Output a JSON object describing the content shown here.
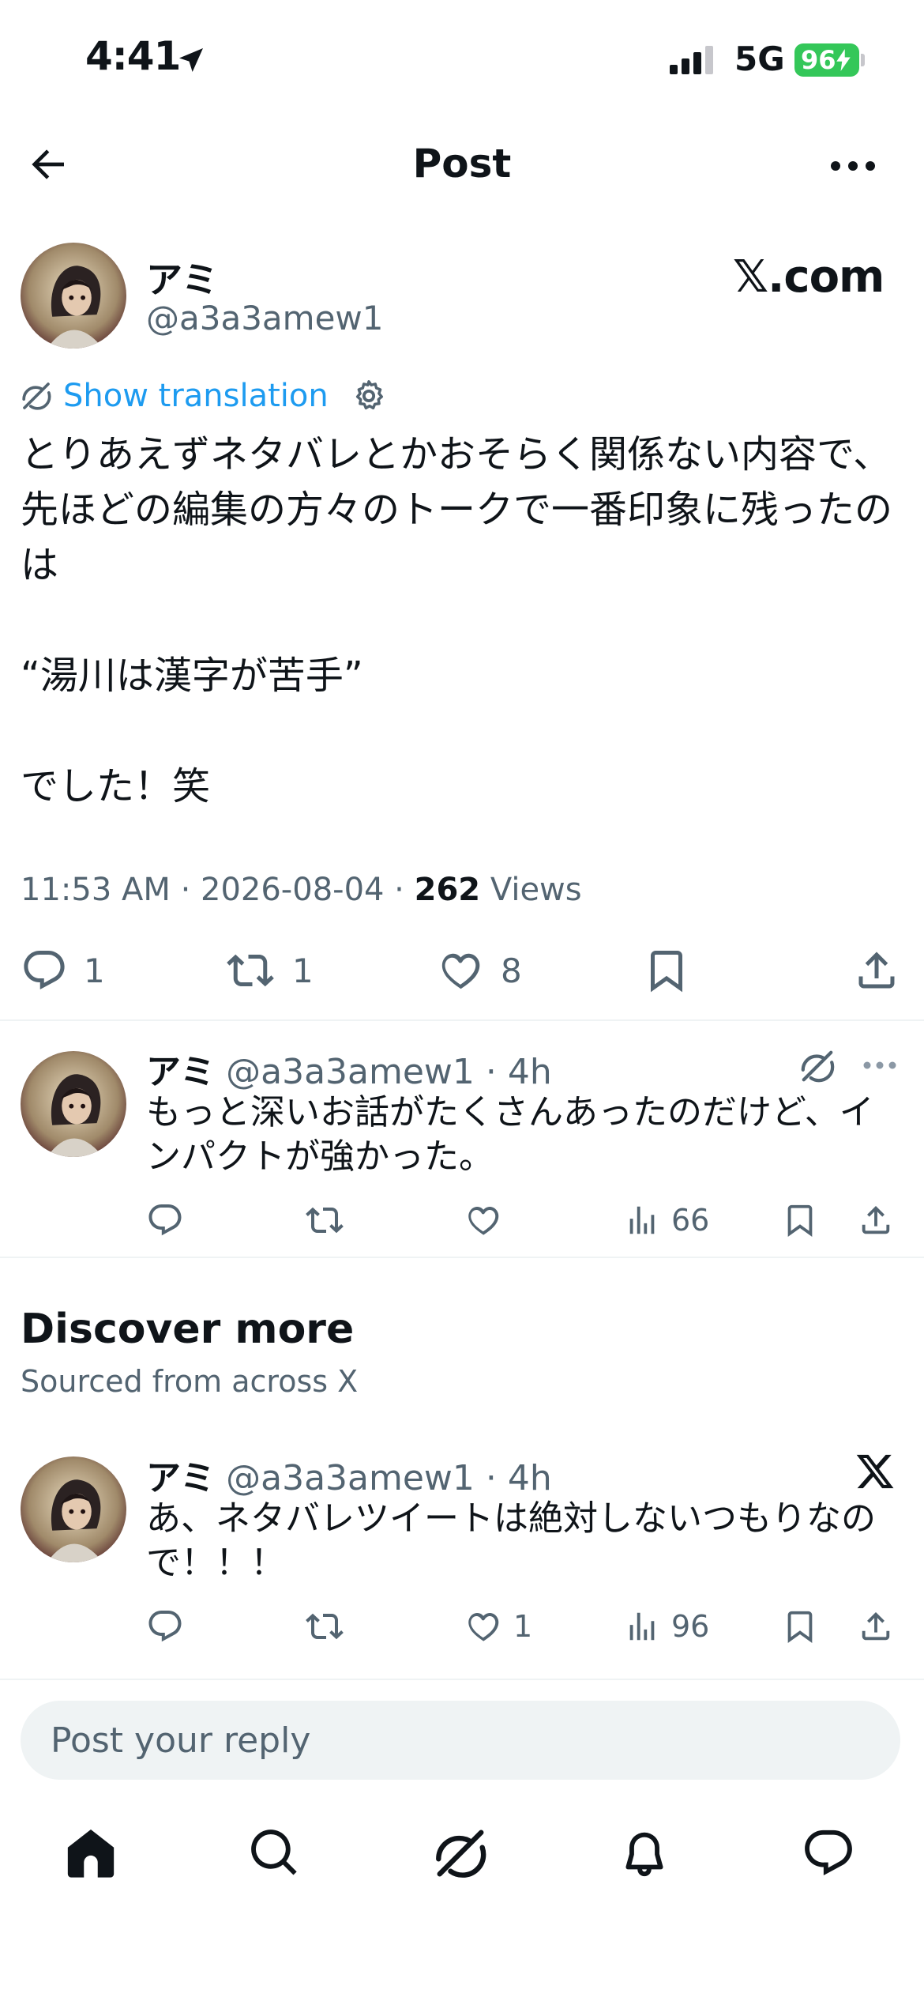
{
  "status_bar": {
    "time": "4:41",
    "network": "5G",
    "battery": "96"
  },
  "header": {
    "title": "Post"
  },
  "main_tweet": {
    "name": "アミ",
    "handle": "@a3a3amew1",
    "source_watermark": "𝕏.com",
    "show_translation": "Show translation",
    "body": "とりあえずネタバレとかおそらく関係ない内容で、先ほどの編集の方々のトークで一番印象に残ったのは\n\n“湯川は漢字が苦手”\n\nでした！笑",
    "timestamp": "11:53 AM · 2026-08-04 · ",
    "views_count": "262",
    "views_label": " Views",
    "replies": "1",
    "reposts": "1",
    "likes": "8"
  },
  "reply_tweet": {
    "name": "アミ",
    "handle_time": " @a3a3amew1 · 4h",
    "body": "もっと深いお話がたくさんあったのだけど、インパクトが強かった。",
    "views": "66"
  },
  "discover": {
    "title": "Discover more",
    "subtitle": "Sourced from across X"
  },
  "discover_tweet": {
    "name": "アミ",
    "handle_time": " @a3a3amew1 · 4h",
    "body": "あ、ネタバレツイートは絶対しないつもりなので！！！",
    "likes": "1",
    "views": "96"
  },
  "reply_input": {
    "placeholder": "Post your reply"
  },
  "icons": {
    "back": "arrow-left-icon",
    "more": "more-horizontal-icon",
    "translate": "grok-icon",
    "settings": "gear-icon",
    "reply": "comment-icon",
    "repost": "repost-icon",
    "like": "heart-icon",
    "bookmark": "bookmark-icon",
    "share": "share-icon",
    "views": "bar-chart-icon",
    "nav": [
      "home-icon",
      "search-icon",
      "grok-icon",
      "bell-icon",
      "messages-icon"
    ]
  },
  "colors": {
    "accent": "#1d9bf0",
    "muted": "#536471",
    "battery": "#34c759"
  }
}
